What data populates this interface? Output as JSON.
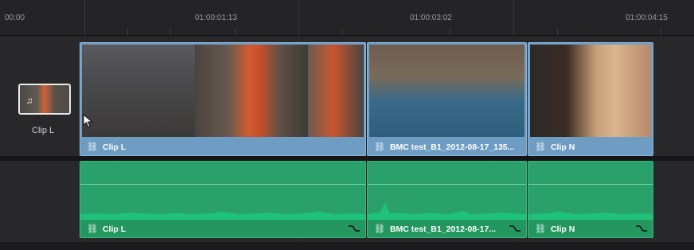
{
  "ruler": {
    "timecodes": [
      "00:00",
      "01:00:01:13",
      "01:00:03:02",
      "01:00:04:15"
    ]
  },
  "floating_clip": {
    "label": "Clip L",
    "icon": "music-note-icon"
  },
  "video_track": {
    "clips": [
      {
        "label": "Clip L",
        "icon": "link-icon"
      },
      {
        "label": "BMC test_B1_2012-08-17_135...",
        "icon": "link-icon"
      },
      {
        "label": "Clip N",
        "icon": "link-icon"
      }
    ]
  },
  "audio_track": {
    "clips": [
      {
        "label": "Clip L",
        "icon": "link-icon",
        "curve_icon": "volume-curve-icon"
      },
      {
        "label": "BMC test_B1_2012-08-17...",
        "icon": "link-icon",
        "curve_icon": "volume-curve-icon"
      },
      {
        "label": "Clip N",
        "icon": "link-icon",
        "curve_icon": "volume-curve-icon"
      }
    ]
  },
  "colors": {
    "video_clip": "#6f9fc6",
    "audio_clip": "#2aa06a",
    "background": "#1b1b1d"
  }
}
